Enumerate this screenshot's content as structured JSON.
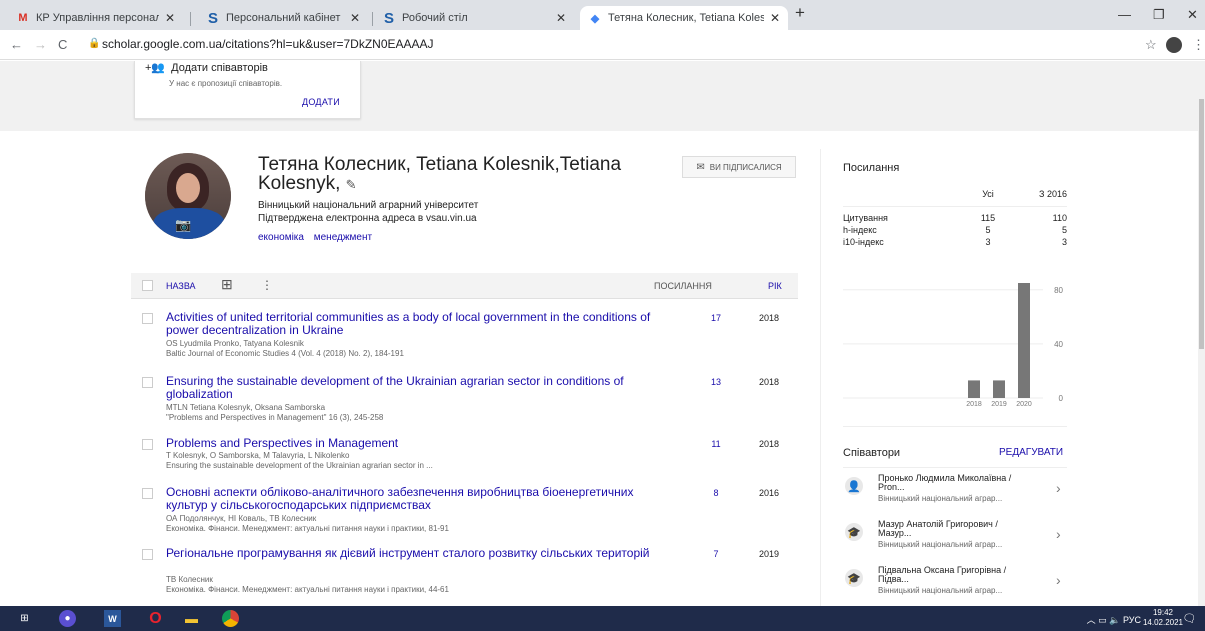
{
  "browser": {
    "tabs": [
      {
        "title": "КР Управління персоналом - sc",
        "icon": "gmail-icon",
        "active": false
      },
      {
        "title": "Персональний кабінет",
        "icon": "s-logo-icon",
        "active": false
      },
      {
        "title": "Робочий стіл",
        "icon": "s-logo-icon",
        "active": false
      },
      {
        "title": "Тетяна Колесник, Tetiana Kolesn",
        "icon": "scholar-icon",
        "active": true
      }
    ],
    "new_tab": "+",
    "url": "scholar.google.com.ua/citations?hl=uk&user=7DkZN0EAAAAJ",
    "colors": {
      "tabstrip": "#dee1e6",
      "link": "#1a0dab",
      "taskbar": "#1f2b4a"
    }
  },
  "coauthor_suggest": {
    "title": "Додати співавторів",
    "subtitle": "У нас є пропозиції співавторів.",
    "button": "ДОДАТИ"
  },
  "profile": {
    "name": "Тетяна Колесник, Tetiana Kolesnik,Tetiana Kolesnyk,",
    "affiliation": "Вінницький національний аграрний університет",
    "email": "Підтверджена електронна адреса в vsau.vin.ua",
    "interests": [
      "економіка",
      "менеджмент"
    ],
    "follow_button": "ВИ ПІДПИСАЛИСЯ"
  },
  "table": {
    "col_title": "НАЗВА",
    "col_cited": "ПОСИЛАННЯ",
    "col_year": "РІК",
    "rows": [
      {
        "title": "Activities of united territorial communities as a body of local government in the conditions of power decentralization in Ukraine",
        "authors": "OS Lyudmila Pronko, Tatyana Kolesnik",
        "venue": "Baltic Journal of Economic Studies 4 (Vol. 4 (2018) No. 2), 184-191",
        "cited": "17",
        "year": "2018"
      },
      {
        "title": "Ensuring the sustainable development of the Ukrainian agrarian sector in conditions of globalization",
        "authors": "MTLN Tetiana Kolesnyk, Oksana Samborska",
        "venue": "\"Problems and Perspectives in Management\" 16 (3), 245-258",
        "cited": "13",
        "year": "2018"
      },
      {
        "title": "Problems and Perspectives in Management",
        "authors": "T Kolesnyk, O Samborska, M Talavyria, L Nikolenko",
        "venue": "Ensuring the sustainable development of the Ukrainian agrarian sector in ...",
        "cited": "11",
        "year": "2018"
      },
      {
        "title": "Основні аспекти обліково-аналітичного забезпечення виробництва біоенергетичних культур у сільськогосподарських підприємствах",
        "authors": "ОА Подолянчук, НІ Коваль, ТВ Колесник",
        "venue": "Економіка. Фінанси. Менеджмент: актуальні питання науки і практики, 81-91",
        "cited": "8",
        "year": "2016"
      },
      {
        "title": "Регіональне програмування як дієвий інструмент сталого розвитку сільських територій",
        "authors": "ТВ Колесник",
        "venue": "Економіка. Фінанси. Менеджмент: актуальні питання науки і практики, 44-61",
        "cited": "7",
        "year": "2019"
      }
    ]
  },
  "stats": {
    "title": "Посилання",
    "col_all": "Усі",
    "col_since": "З 2016",
    "rows": [
      {
        "label": "Цитування",
        "all": "115",
        "since": "110"
      },
      {
        "label": "h-індекс",
        "all": "5",
        "since": "5"
      },
      {
        "label": "i10-індекс",
        "all": "3",
        "since": "3"
      }
    ]
  },
  "chart_data": {
    "type": "bar",
    "categories": [
      "2018",
      "2019",
      "2020"
    ],
    "values": [
      13,
      13,
      85
    ],
    "yticks": [
      "80",
      "40",
      "0"
    ],
    "ylim": [
      0,
      85
    ],
    "bar_color": "#777777"
  },
  "coauthors": {
    "title": "Співавтори",
    "edit": "РЕДАГУВАТИ",
    "items": [
      {
        "name": "Пронько Людмила Миколаївна / Pron...",
        "affil": "Вінницький національний аграр..."
      },
      {
        "name": "Мазур Анатолій Григорович / Мазур...",
        "affil": "Вінницький національний аграр..."
      },
      {
        "name": "Підвальна Оксана Григорівна / Підва...",
        "affil": "Вінницький національний аграр..."
      }
    ]
  },
  "taskbar": {
    "lang": "РУС",
    "time": "19:42",
    "date": "14.02.2021"
  }
}
